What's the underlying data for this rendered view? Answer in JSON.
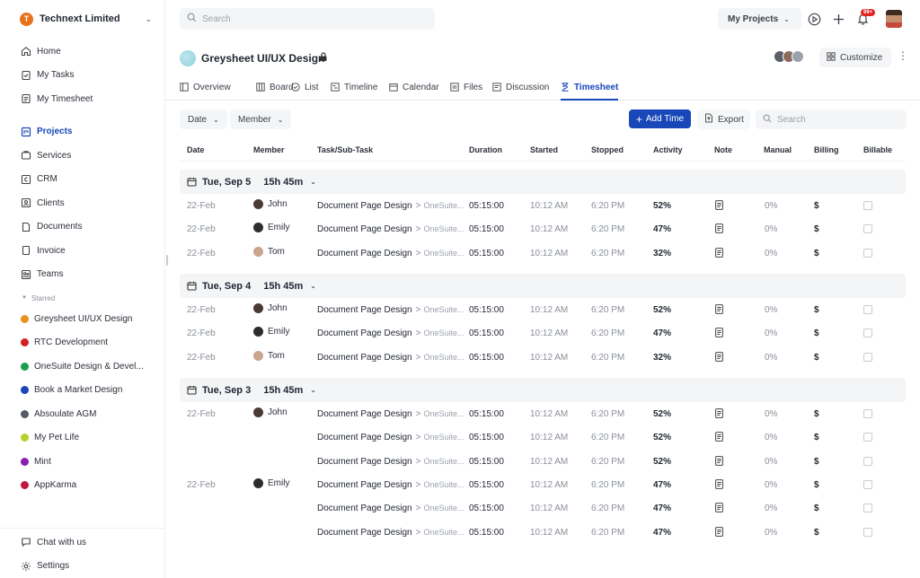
{
  "org": {
    "name": "Technext Limited",
    "initial": "T"
  },
  "sidebar": {
    "items": [
      {
        "label": "Home",
        "icon": "home-icon"
      },
      {
        "label": "My Tasks",
        "icon": "tasks-icon"
      },
      {
        "label": "My Timesheet",
        "icon": "timesheet-icon"
      },
      {
        "label": "Projects",
        "icon": "projects-icon",
        "active": true
      },
      {
        "label": "Services",
        "icon": "services-icon"
      },
      {
        "label": "CRM",
        "icon": "crm-icon"
      },
      {
        "label": "Clients",
        "icon": "clients-icon"
      },
      {
        "label": "Documents",
        "icon": "documents-icon"
      },
      {
        "label": "Invoice",
        "icon": "invoice-icon"
      },
      {
        "label": "Teams",
        "icon": "teams-icon"
      }
    ],
    "starred_label": "Starred",
    "starred": [
      {
        "label": "Greysheet UI/UX Design",
        "color": "#e9901c"
      },
      {
        "label": "RTC Development",
        "color": "#d42020"
      },
      {
        "label": "OneSuite Design & Devel...",
        "color": "#18a04a"
      },
      {
        "label": "Book a Market Design",
        "color": "#1747b8"
      },
      {
        "label": "Absoulate AGM",
        "color": "#555a63"
      },
      {
        "label": "My Pet Life",
        "color": "#b7d02a"
      },
      {
        "label": "Mint",
        "color": "#8a1fb0"
      },
      {
        "label": "AppKarma",
        "color": "#c0193f"
      }
    ],
    "bottom": [
      {
        "label": "Chat with us",
        "icon": "chat-icon"
      },
      {
        "label": "Settings",
        "icon": "settings-icon"
      }
    ]
  },
  "topbar": {
    "search_placeholder": "Search",
    "my_projects": "My Projects",
    "notification_count": "99+"
  },
  "project": {
    "title": "Greysheet UI/UX Design",
    "customize_label": "Customize"
  },
  "tabs": [
    {
      "label": "Overview"
    },
    {
      "label": "Board"
    },
    {
      "label": "List"
    },
    {
      "label": "Timeline"
    },
    {
      "label": "Calendar"
    },
    {
      "label": "Files"
    },
    {
      "label": "Discussion"
    },
    {
      "label": "Timesheet",
      "active": true
    }
  ],
  "toolbar": {
    "date_filter": "Date",
    "member_filter": "Member",
    "add_time": "Add Time",
    "export": "Export",
    "search_placeholder": "Search"
  },
  "table": {
    "columns": [
      "Date",
      "Member",
      "Task/Sub-Task",
      "Duration",
      "Started",
      "Stopped",
      "Activity",
      "Note",
      "Manual",
      "Billing",
      "Billable"
    ],
    "groups": [
      {
        "label": "Tue, Sep 5",
        "total": "15h 45m",
        "rows": [
          {
            "date": "22-Feb",
            "member": "John",
            "task": "Document Page Design",
            "sub": "OneSuite...",
            "duration": "05:15:00",
            "started": "10:12 AM",
            "stopped": "6:20 PM",
            "activity": "52%",
            "manual": "0%",
            "billing": "$"
          },
          {
            "date": "22-Feb",
            "member": "Emily",
            "task": "Document Page Design",
            "sub": "OneSuite...",
            "duration": "05:15:00",
            "started": "10:12 AM",
            "stopped": "6:20 PM",
            "activity": "47%",
            "manual": "0%",
            "billing": "$"
          },
          {
            "date": "22-Feb",
            "member": "Tom",
            "task": "Document Page Design",
            "sub": "OneSuite...",
            "duration": "05:15:00",
            "started": "10:12 AM",
            "stopped": "6:20 PM",
            "activity": "32%",
            "manual": "0%",
            "billing": "$"
          }
        ]
      },
      {
        "label": "Tue, Sep 4",
        "total": "15h 45m",
        "rows": [
          {
            "date": "22-Feb",
            "member": "John",
            "task": "Document Page Design",
            "sub": "OneSuite...",
            "duration": "05:15:00",
            "started": "10:12 AM",
            "stopped": "6:20 PM",
            "activity": "52%",
            "manual": "0%",
            "billing": "$"
          },
          {
            "date": "22-Feb",
            "member": "Emily",
            "task": "Document Page Design",
            "sub": "OneSuite...",
            "duration": "05:15:00",
            "started": "10:12 AM",
            "stopped": "6:20 PM",
            "activity": "47%",
            "manual": "0%",
            "billing": "$"
          },
          {
            "date": "22-Feb",
            "member": "Tom",
            "task": "Document Page Design",
            "sub": "OneSuite...",
            "duration": "05:15:00",
            "started": "10:12 AM",
            "stopped": "6:20 PM",
            "activity": "32%",
            "manual": "0%",
            "billing": "$"
          }
        ]
      },
      {
        "label": "Tue, Sep 3",
        "total": "15h 45m",
        "rows": [
          {
            "date": "22-Feb",
            "member": "John",
            "task": "Document Page Design",
            "sub": "OneSuite...",
            "duration": "05:15:00",
            "started": "10:12 AM",
            "stopped": "6:20 PM",
            "activity": "52%",
            "manual": "0%",
            "billing": "$"
          },
          {
            "date": "",
            "member": "",
            "task": "Document Page Design",
            "sub": "OneSuite...",
            "duration": "05:15:00",
            "started": "10:12 AM",
            "stopped": "6:20 PM",
            "activity": "52%",
            "manual": "0%",
            "billing": "$"
          },
          {
            "date": "",
            "member": "",
            "task": "Document Page Design",
            "sub": "OneSuite...",
            "duration": "05:15:00",
            "started": "10:12 AM",
            "stopped": "6:20 PM",
            "activity": "52%",
            "manual": "0%",
            "billing": "$"
          },
          {
            "date": "22-Feb",
            "member": "Emily",
            "task": "Document Page Design",
            "sub": "OneSuite...",
            "duration": "05:15:00",
            "started": "10:12 AM",
            "stopped": "6:20 PM",
            "activity": "47%",
            "manual": "0%",
            "billing": "$"
          },
          {
            "date": "",
            "member": "",
            "task": "Document Page Design",
            "sub": "OneSuite...",
            "duration": "05:15:00",
            "started": "10:12 AM",
            "stopped": "6:20 PM",
            "activity": "47%",
            "manual": "0%",
            "billing": "$"
          },
          {
            "date": "",
            "member": "",
            "task": "Document Page Design",
            "sub": "OneSuite...",
            "duration": "05:15:00",
            "started": "10:12 AM",
            "stopped": "6:20 PM",
            "activity": "47%",
            "manual": "0%",
            "billing": "$"
          }
        ]
      }
    ]
  }
}
